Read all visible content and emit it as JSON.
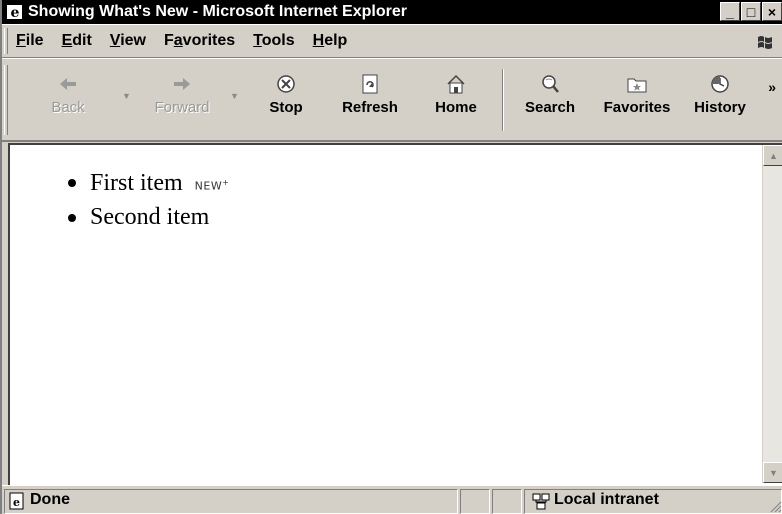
{
  "window": {
    "title": "Showing What's New - Microsoft Internet Explorer",
    "controls": {
      "minimize": "_",
      "maximize": "□",
      "close": "×"
    }
  },
  "menu": {
    "items": [
      {
        "label": "File",
        "accel": "F",
        "rest": "ile"
      },
      {
        "label": "Edit",
        "accel": "E",
        "rest": "dit"
      },
      {
        "label": "View",
        "accel": "V",
        "rest": "iew"
      },
      {
        "label": "Favorites",
        "pre": "F",
        "accel": "a",
        "rest": "vorites"
      },
      {
        "label": "Tools",
        "accel": "T",
        "rest": "ools"
      },
      {
        "label": "Help",
        "accel": "H",
        "rest": "elp"
      }
    ]
  },
  "toolbar": {
    "back": "Back",
    "forward": "Forward",
    "stop": "Stop",
    "refresh": "Refresh",
    "home": "Home",
    "search": "Search",
    "favorites": "Favorites",
    "history": "History",
    "more": "»"
  },
  "content": {
    "items": [
      {
        "text": "First item",
        "badge": "NEW"
      },
      {
        "text": "Second item"
      }
    ]
  },
  "status": {
    "text": "Done",
    "zone": "Local intranet"
  }
}
